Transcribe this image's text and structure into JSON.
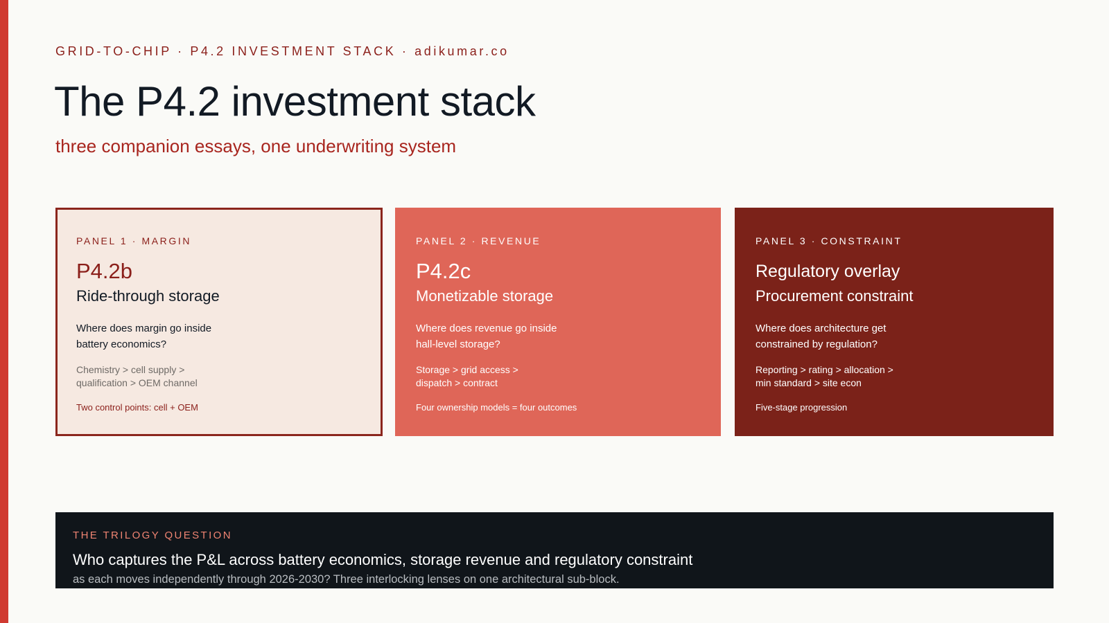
{
  "header": {
    "eyebrow": "GRID-TO-CHIP · P4.2 INVESTMENT STACK · adikumar.co",
    "title": "The P4.2 investment stack",
    "subtitle": "three companion essays, one underwriting system"
  },
  "panels": [
    {
      "eyebrow": "PANEL 1 · MARGIN",
      "code": "P4.2b",
      "name": "Ride-through storage",
      "question": "Where does margin go inside battery economics?",
      "path": "Chemistry > cell supply > qualification > OEM channel",
      "note": "Two control points: cell + OEM"
    },
    {
      "eyebrow": "PANEL 2 · REVENUE",
      "code": "P4.2c",
      "name": "Monetizable storage",
      "question": "Where does revenue go inside hall-level storage?",
      "path": "Storage > grid access > dispatch > contract",
      "note": "Four ownership models = four outcomes"
    },
    {
      "eyebrow": "PANEL 3 · CONSTRAINT",
      "code": "Regulatory overlay",
      "name": "Procurement constraint",
      "question": "Where does architecture get constrained by regulation?",
      "path": "Reporting > rating > allocation > min standard > site econ",
      "note": "Five-stage progression"
    }
  ],
  "footer": {
    "eyebrow": "THE TRILOGY QUESTION",
    "question": "Who captures the P&L across battery economics, storage revenue and regulatory constraint",
    "sub": "as each moves independently through 2026-2030? Three interlocking lenses on one architectural sub-block."
  },
  "colors": {
    "accent": "#d03a32",
    "panel1_bg": "#f6e9e1",
    "panel2_bg": "#df6658",
    "panel3_bg": "#7b2219",
    "footer_bg": "#10151a"
  }
}
